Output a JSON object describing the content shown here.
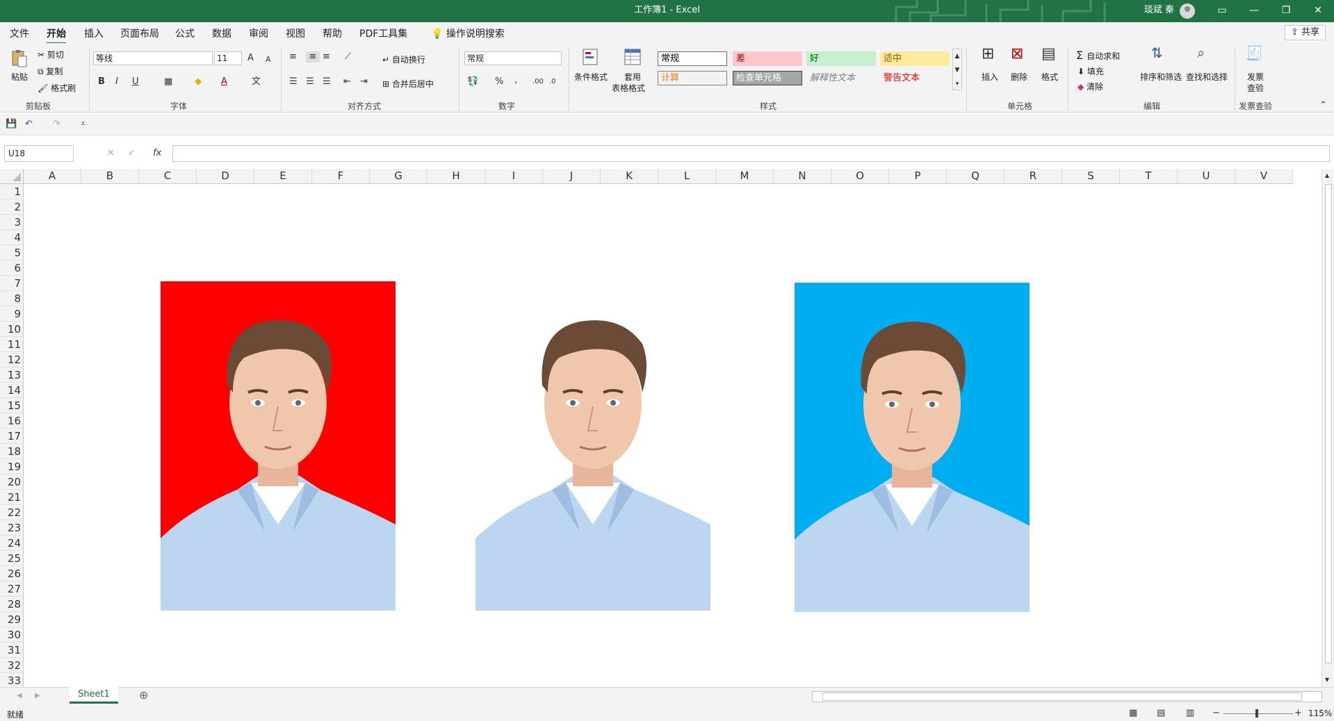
{
  "window": {
    "title": "工作簿1  -  Excel",
    "user": "琰斌 秦",
    "buttons": [
      "ribbon-display",
      "minimize",
      "restore",
      "close"
    ]
  },
  "menu": {
    "tabs": [
      "文件",
      "开始",
      "插入",
      "页面布局",
      "公式",
      "数据",
      "审阅",
      "视图",
      "帮助",
      "PDF工具集"
    ],
    "active": "开始",
    "search": "操作说明搜索",
    "share": "共享"
  },
  "ribbon": {
    "clipboard": {
      "paste": "粘贴",
      "cut": "剪切",
      "copy": "复制",
      "format_painter": "格式刷",
      "label": "剪贴板"
    },
    "font": {
      "name": "等线",
      "size": "11",
      "bold": "B",
      "italic": "I",
      "underline": "U",
      "grow": "A",
      "shrink": "A",
      "font_color": "A",
      "label": "字体"
    },
    "alignment": {
      "wrap": "自动换行",
      "merge": "合并后居中",
      "label": "对齐方式"
    },
    "number": {
      "format": "常规",
      "percent": "%",
      "comma": ",",
      "label": "数字"
    },
    "styles": {
      "conditional": "条件格式",
      "table_1": "套用",
      "table_2": "表格格式",
      "cells": [
        {
          "text": "常规",
          "bg": "#ffffff",
          "fg": "#000000",
          "border": "#6b6b6b"
        },
        {
          "text": "差",
          "bg": "#ffc7ce",
          "fg": "#9c0006",
          "border": "#ffc7ce"
        },
        {
          "text": "好",
          "bg": "#c6efce",
          "fg": "#006100",
          "border": "#c6efce"
        },
        {
          "text": "适中",
          "bg": "#ffeb9c",
          "fg": "#9c5700",
          "border": "#ffeb9c"
        },
        {
          "text": "计算",
          "bg": "#f2f2f2",
          "fg": "#fa7d00",
          "border": "#7f7f7f"
        },
        {
          "text": "检查单元格",
          "bg": "#a5a5a5",
          "fg": "#ffffff",
          "border": "#3f3f3f"
        },
        {
          "text": "解释性文本",
          "bg": "transparent",
          "fg": "#7f7f7f",
          "border": "transparent"
        },
        {
          "text": "警告文本",
          "bg": "transparent",
          "fg": "#ff0000",
          "border": "transparent"
        }
      ],
      "label": "样式"
    },
    "cells": {
      "insert": "插入",
      "delete": "删除",
      "format": "格式",
      "label": "单元格"
    },
    "editing": {
      "autosum": "自动求和",
      "fill": "填充",
      "clear": "清除",
      "sort": "排序和筛选",
      "find": "查找和选择",
      "label": "编辑"
    },
    "invoice": {
      "line1": "发票",
      "line2": "查验",
      "label": "发票查验"
    }
  },
  "formula_bar": {
    "name_box": "U18",
    "fx": "fx",
    "cancel": "✕",
    "enter": "✓",
    "value": ""
  },
  "grid": {
    "columns": [
      "A",
      "B",
      "C",
      "D",
      "E",
      "F",
      "G",
      "H",
      "I",
      "J",
      "K",
      "L",
      "M",
      "N",
      "O",
      "P",
      "Q",
      "R",
      "S",
      "T",
      "U",
      "V"
    ],
    "rows": [
      "1",
      "2",
      "3",
      "4",
      "5",
      "6",
      "7",
      "8",
      "9",
      "10",
      "11",
      "12",
      "13",
      "14",
      "15",
      "16",
      "17",
      "18",
      "19",
      "20",
      "21",
      "22",
      "23",
      "24",
      "25",
      "26",
      "27",
      "28",
      "29",
      "30",
      "31",
      "32",
      "33"
    ]
  },
  "photos": [
    {
      "background": "#ff0000"
    },
    {
      "background": "#ffffff"
    },
    {
      "background": "#00aeef"
    }
  ],
  "sheets": {
    "tabs": [
      "Sheet1"
    ],
    "active": "Sheet1"
  },
  "status": {
    "text": "就绪",
    "zoom": "115%"
  }
}
